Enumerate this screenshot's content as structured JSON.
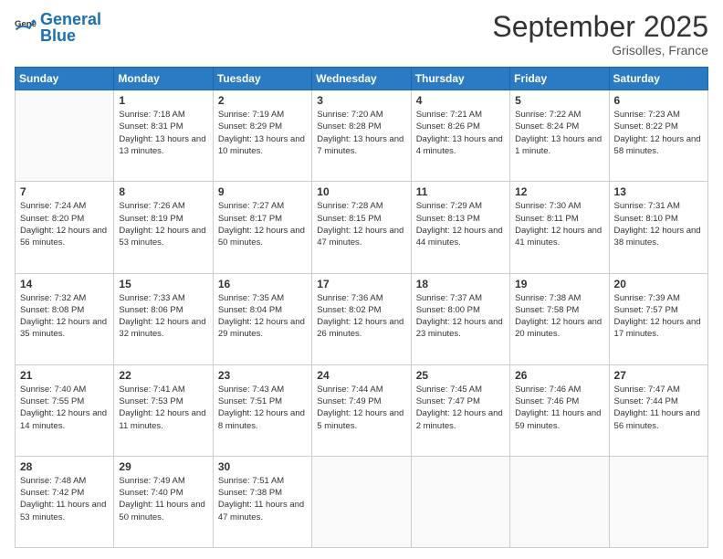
{
  "header": {
    "logo_general": "General",
    "logo_blue": "Blue",
    "month_year": "September 2025",
    "location": "Grisolles, France"
  },
  "columns": [
    "Sunday",
    "Monday",
    "Tuesday",
    "Wednesday",
    "Thursday",
    "Friday",
    "Saturday"
  ],
  "weeks": [
    [
      {
        "date": "",
        "info": ""
      },
      {
        "date": "1",
        "info": "Sunrise: 7:18 AM\nSunset: 8:31 PM\nDaylight: 13 hours and 13 minutes."
      },
      {
        "date": "2",
        "info": "Sunrise: 7:19 AM\nSunset: 8:29 PM\nDaylight: 13 hours and 10 minutes."
      },
      {
        "date": "3",
        "info": "Sunrise: 7:20 AM\nSunset: 8:28 PM\nDaylight: 13 hours and 7 minutes."
      },
      {
        "date": "4",
        "info": "Sunrise: 7:21 AM\nSunset: 8:26 PM\nDaylight: 13 hours and 4 minutes."
      },
      {
        "date": "5",
        "info": "Sunrise: 7:22 AM\nSunset: 8:24 PM\nDaylight: 13 hours and 1 minute."
      },
      {
        "date": "6",
        "info": "Sunrise: 7:23 AM\nSunset: 8:22 PM\nDaylight: 12 hours and 58 minutes."
      }
    ],
    [
      {
        "date": "7",
        "info": "Sunrise: 7:24 AM\nSunset: 8:20 PM\nDaylight: 12 hours and 56 minutes."
      },
      {
        "date": "8",
        "info": "Sunrise: 7:26 AM\nSunset: 8:19 PM\nDaylight: 12 hours and 53 minutes."
      },
      {
        "date": "9",
        "info": "Sunrise: 7:27 AM\nSunset: 8:17 PM\nDaylight: 12 hours and 50 minutes."
      },
      {
        "date": "10",
        "info": "Sunrise: 7:28 AM\nSunset: 8:15 PM\nDaylight: 12 hours and 47 minutes."
      },
      {
        "date": "11",
        "info": "Sunrise: 7:29 AM\nSunset: 8:13 PM\nDaylight: 12 hours and 44 minutes."
      },
      {
        "date": "12",
        "info": "Sunrise: 7:30 AM\nSunset: 8:11 PM\nDaylight: 12 hours and 41 minutes."
      },
      {
        "date": "13",
        "info": "Sunrise: 7:31 AM\nSunset: 8:10 PM\nDaylight: 12 hours and 38 minutes."
      }
    ],
    [
      {
        "date": "14",
        "info": "Sunrise: 7:32 AM\nSunset: 8:08 PM\nDaylight: 12 hours and 35 minutes."
      },
      {
        "date": "15",
        "info": "Sunrise: 7:33 AM\nSunset: 8:06 PM\nDaylight: 12 hours and 32 minutes."
      },
      {
        "date": "16",
        "info": "Sunrise: 7:35 AM\nSunset: 8:04 PM\nDaylight: 12 hours and 29 minutes."
      },
      {
        "date": "17",
        "info": "Sunrise: 7:36 AM\nSunset: 8:02 PM\nDaylight: 12 hours and 26 minutes."
      },
      {
        "date": "18",
        "info": "Sunrise: 7:37 AM\nSunset: 8:00 PM\nDaylight: 12 hours and 23 minutes."
      },
      {
        "date": "19",
        "info": "Sunrise: 7:38 AM\nSunset: 7:58 PM\nDaylight: 12 hours and 20 minutes."
      },
      {
        "date": "20",
        "info": "Sunrise: 7:39 AM\nSunset: 7:57 PM\nDaylight: 12 hours and 17 minutes."
      }
    ],
    [
      {
        "date": "21",
        "info": "Sunrise: 7:40 AM\nSunset: 7:55 PM\nDaylight: 12 hours and 14 minutes."
      },
      {
        "date": "22",
        "info": "Sunrise: 7:41 AM\nSunset: 7:53 PM\nDaylight: 12 hours and 11 minutes."
      },
      {
        "date": "23",
        "info": "Sunrise: 7:43 AM\nSunset: 7:51 PM\nDaylight: 12 hours and 8 minutes."
      },
      {
        "date": "24",
        "info": "Sunrise: 7:44 AM\nSunset: 7:49 PM\nDaylight: 12 hours and 5 minutes."
      },
      {
        "date": "25",
        "info": "Sunrise: 7:45 AM\nSunset: 7:47 PM\nDaylight: 12 hours and 2 minutes."
      },
      {
        "date": "26",
        "info": "Sunrise: 7:46 AM\nSunset: 7:46 PM\nDaylight: 11 hours and 59 minutes."
      },
      {
        "date": "27",
        "info": "Sunrise: 7:47 AM\nSunset: 7:44 PM\nDaylight: 11 hours and 56 minutes."
      }
    ],
    [
      {
        "date": "28",
        "info": "Sunrise: 7:48 AM\nSunset: 7:42 PM\nDaylight: 11 hours and 53 minutes."
      },
      {
        "date": "29",
        "info": "Sunrise: 7:49 AM\nSunset: 7:40 PM\nDaylight: 11 hours and 50 minutes."
      },
      {
        "date": "30",
        "info": "Sunrise: 7:51 AM\nSunset: 7:38 PM\nDaylight: 11 hours and 47 minutes."
      },
      {
        "date": "",
        "info": ""
      },
      {
        "date": "",
        "info": ""
      },
      {
        "date": "",
        "info": ""
      },
      {
        "date": "",
        "info": ""
      }
    ]
  ]
}
